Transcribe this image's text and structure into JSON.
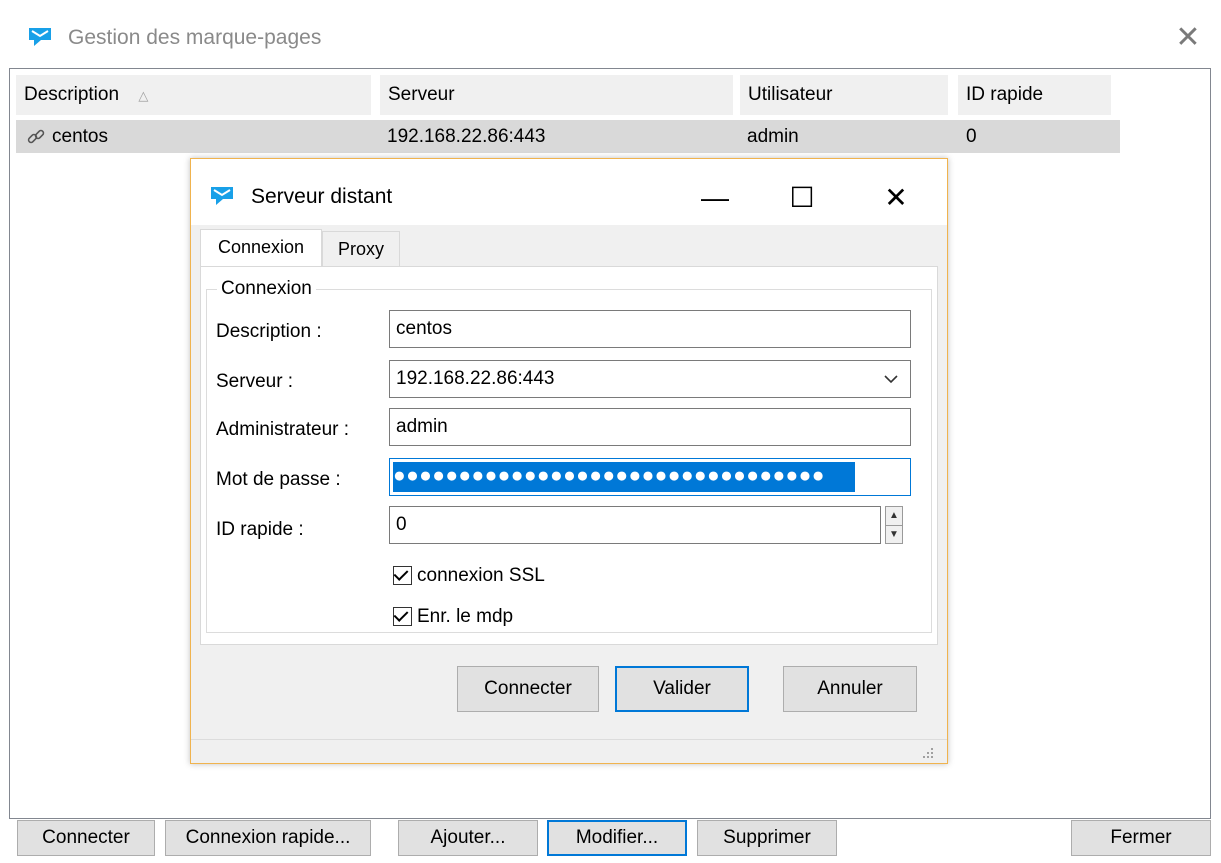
{
  "outer": {
    "title": "Gestion des marque-pages",
    "close_icon": "close-icon"
  },
  "list": {
    "columns": [
      "Description",
      "Serveur",
      "Utilisateur",
      "ID rapide"
    ],
    "sort_indicator": "△",
    "rows": [
      {
        "description": "centos",
        "server": "192.168.22.86:443",
        "user": "admin",
        "quick_id": "0",
        "icon": "link-icon"
      }
    ]
  },
  "bottom_buttons": {
    "connect": "Connecter",
    "quick_connect": "Connexion rapide...",
    "add": "Ajouter...",
    "modify": "Modifier...",
    "delete": "Supprimer",
    "close": "Fermer"
  },
  "dialog": {
    "title": "Serveur distant",
    "minimize": "—",
    "maximize": "☐",
    "close": "✕",
    "tabs": [
      "Connexion",
      "Proxy"
    ],
    "group_label": "Connexion",
    "fields": {
      "description_label": "Description :",
      "description_value": "centos",
      "server_label": "Serveur :",
      "server_value": "192.168.22.86:443",
      "admin_label": "Administrateur :",
      "admin_value": "admin",
      "password_label": "Mot de passe :",
      "password_value": "●●●●●●●●●●●●●●●●●●●●●●●●●●●●●●●●●",
      "quick_id_label": "ID rapide :",
      "quick_id_value": "0"
    },
    "checkboxes": {
      "ssl_label": "connexion SSL",
      "ssl_checked": true,
      "save_pwd_label": "Enr. le mdp",
      "save_pwd_checked": true
    },
    "buttons": {
      "connect": "Connecter",
      "validate": "Valider",
      "cancel": "Annuler"
    }
  },
  "colors": {
    "accent": "#0078d7",
    "selection_row": "#d9d9d9",
    "dialog_border": "#f0b34e"
  }
}
